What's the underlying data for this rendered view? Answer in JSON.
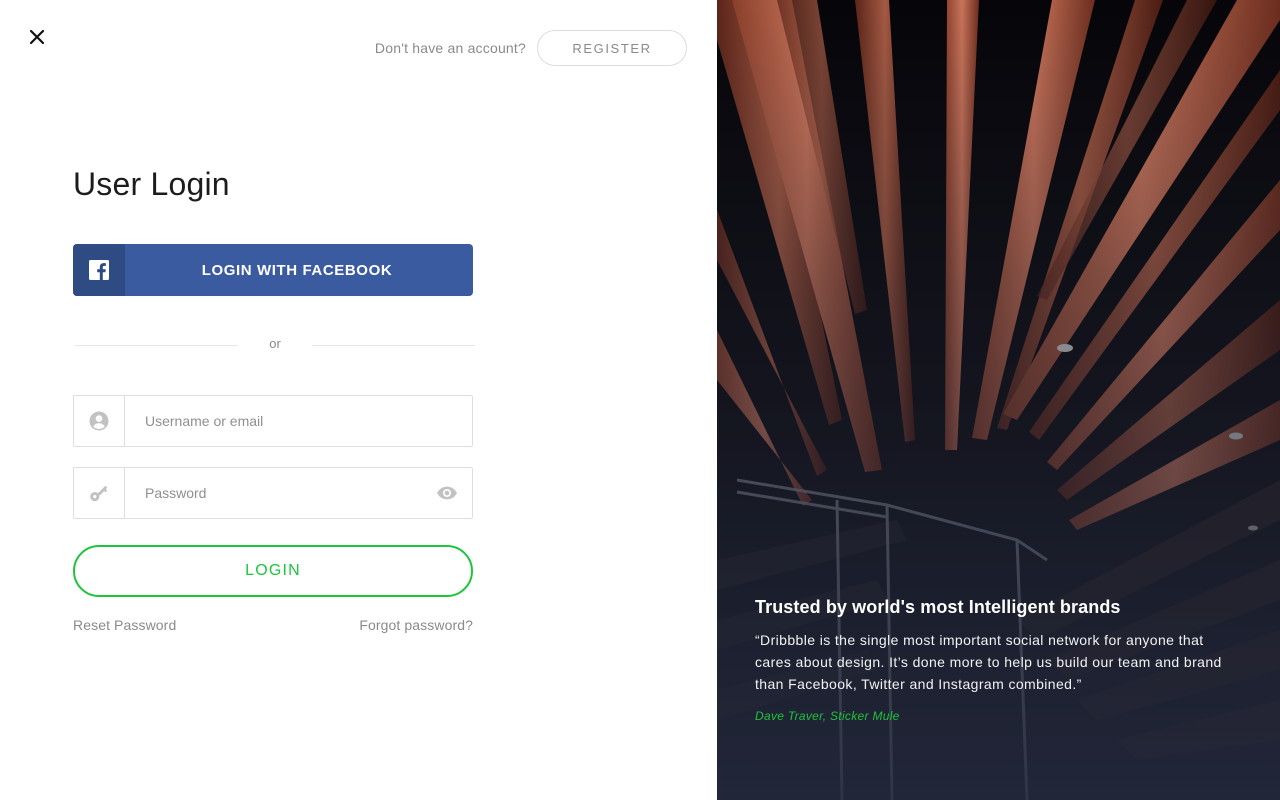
{
  "header": {
    "account_prompt": "Don't have an account?",
    "register_label": "REGISTER"
  },
  "login": {
    "title": "User Login",
    "facebook_label": "LOGIN WITH FACEBOOK",
    "divider_text": "or",
    "username_placeholder": "Username or email",
    "password_placeholder": "Password",
    "login_label": "LOGIN",
    "reset_label": "Reset Password",
    "forgot_label": "Forgot password?"
  },
  "testimonial": {
    "title": "Trusted by world's most Intelligent brands",
    "quote": "“Dribbble is the single most important social network for anyone that cares about design. It’s done more to help us build our team and brand than Facebook, Twitter and Instagram combined.”",
    "author": "Dave Traver, Sticker Mule"
  },
  "icons": {
    "close": "close-icon",
    "facebook": "facebook-icon",
    "user": "user-icon",
    "key": "key-icon",
    "eye": "eye-icon"
  },
  "colors": {
    "accent_green": "#1ec43c",
    "facebook_blue": "#3a5ba0",
    "facebook_blue_dark": "#2f4b84",
    "text_muted": "#8a8a8a"
  }
}
